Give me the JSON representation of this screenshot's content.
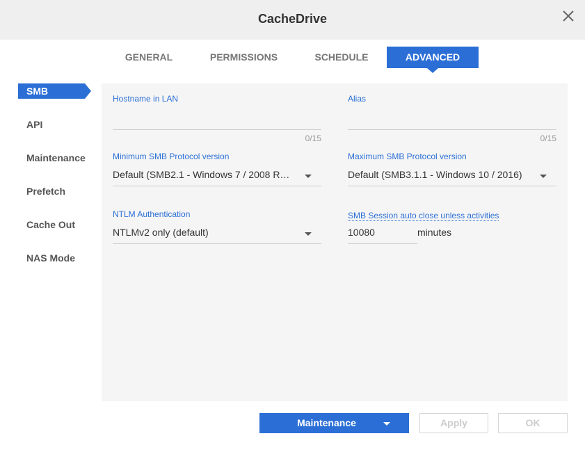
{
  "window": {
    "title": "CacheDrive"
  },
  "tabs": [
    {
      "label": "GENERAL"
    },
    {
      "label": "PERMISSIONS"
    },
    {
      "label": "SCHEDULE"
    },
    {
      "label": "ADVANCED"
    }
  ],
  "sidebar": {
    "items": [
      {
        "label": "SMB"
      },
      {
        "label": "API"
      },
      {
        "label": "Maintenance"
      },
      {
        "label": "Prefetch"
      },
      {
        "label": "Cache Out"
      },
      {
        "label": "NAS Mode"
      }
    ]
  },
  "smb": {
    "hostname": {
      "label": "Hostname in LAN",
      "value": "",
      "counter": "0/15"
    },
    "alias": {
      "label": "Alias",
      "value": "",
      "counter": "0/15"
    },
    "min_protocol": {
      "label": "Minimum SMB Protocol version",
      "value": "Default (SMB2.1 - Windows 7 / 2008 R…"
    },
    "max_protocol": {
      "label": "Maximum SMB Protocol version",
      "value": "Default (SMB3.1.1 - Windows 10 / 2016)"
    },
    "ntlm": {
      "label": "NTLM Authentication",
      "value": "NTLMv2 only (default)"
    },
    "session_close": {
      "label": "SMB Session auto close unless activities",
      "value": "10080",
      "unit": "minutes"
    }
  },
  "footer": {
    "maintenance_label": "Maintenance",
    "apply_label": "Apply",
    "ok_label": "OK"
  },
  "colors": {
    "accent": "#2b6fd6",
    "panel": "#f5f5f5",
    "titlebar": "#efefef"
  }
}
